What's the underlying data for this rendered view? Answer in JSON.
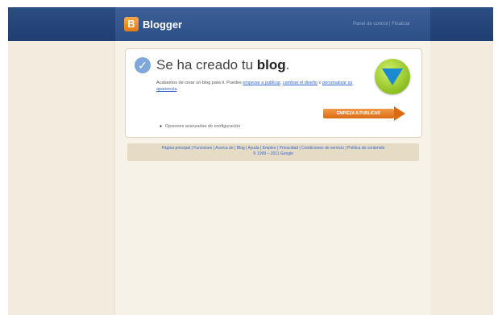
{
  "header": {
    "app_name": "Blogger",
    "logo_letter": "B",
    "top_link": "Panel de control | Finalizar"
  },
  "card": {
    "title_prefix": "Se ha creado tu ",
    "title_bold": "blog",
    "title_suffix": ".",
    "description_start": "Acabamos de crear un blog para ti. Puedes ",
    "description_link1": "empezar a publicar",
    "description_middle": ", ",
    "description_link2": "cambiar el diseño",
    "description_end": " o ",
    "description_link3": "personalizar su apariencia",
    "description_tail": ".",
    "cta_label": "EMPIEZA A PUBLICAR",
    "config_link": "Opciones avanzadas de configuración"
  },
  "footer": {
    "line1": "Página principal | Funciones | Acerca de | Blog | Ayuda | Empleo | Privacidad | Condiciones de servicio | Política de contenido",
    "line2": "© 1999 – 2011 Google"
  }
}
